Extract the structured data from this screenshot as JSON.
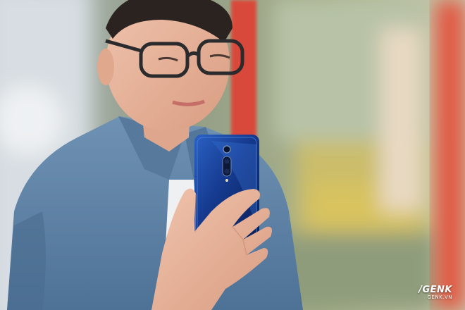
{
  "photo": {
    "subject": "man-holding-blue-smartphone",
    "colors": {
      "phone": "#1d3f9c",
      "shirt": "#5f84a8",
      "skin": "#e8b49c",
      "red_pole": "#d9483a",
      "background": "#a7b49a"
    }
  },
  "watermark": {
    "logo": "/GENK",
    "site": "GENK.VN"
  }
}
